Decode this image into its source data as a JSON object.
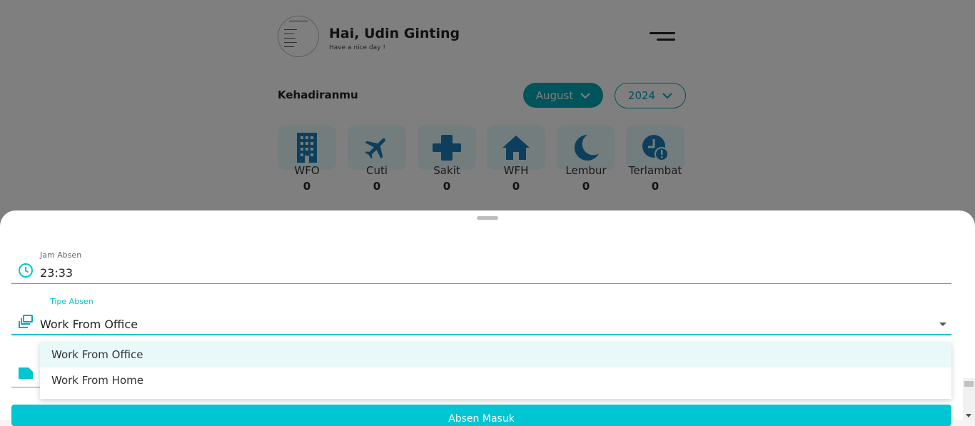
{
  "header": {
    "greeting": "Hai, Udin Ginting",
    "subtitle": "Have a nice day !"
  },
  "attendance": {
    "title": "Kehadiranmu",
    "month": "August",
    "year": "2024",
    "stats": [
      {
        "label": "WFO",
        "value": "0",
        "icon": "office-building-icon"
      },
      {
        "label": "Cuti",
        "value": "0",
        "icon": "airplane-icon"
      },
      {
        "label": "Sakit",
        "value": "0",
        "icon": "medical-cross-icon"
      },
      {
        "label": "WFH",
        "value": "0",
        "icon": "home-icon"
      },
      {
        "label": "Lembur",
        "value": "0",
        "icon": "moon-icon"
      },
      {
        "label": "Terlambat",
        "value": "0",
        "icon": "clock-alert-icon"
      }
    ]
  },
  "form": {
    "jam_label": "Jam Absen",
    "jam_value": "23:33",
    "tipe_label": "Tipe Absen",
    "tipe_value": "Work From Office",
    "options": [
      "Work From Office",
      "Work From Home"
    ],
    "submit_label": "Absen Masuk"
  },
  "colors": {
    "accent": "#00a9b8",
    "accent_light": "#00c5d3",
    "icon_blue": "#1a7fb8",
    "stat_bg": "#e6fbfd"
  }
}
